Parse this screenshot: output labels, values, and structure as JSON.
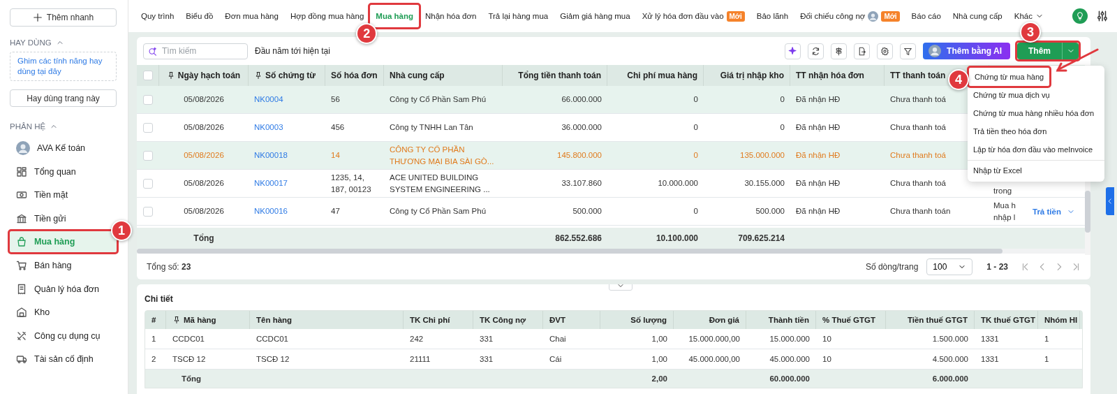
{
  "sidebar": {
    "quick_add": "Thêm nhanh",
    "favorites": {
      "title": "HAY DÙNG",
      "expanded": true,
      "hint": "Ghim các tính năng hay dùng tại đây",
      "button": "Hay dùng trang này"
    },
    "modules": {
      "title": "PHÂN HỆ",
      "expanded": true,
      "items": [
        {
          "label": "AVA Kế toán",
          "selected": false
        },
        {
          "label": "Tổng quan",
          "selected": false
        },
        {
          "label": "Tiền mặt",
          "selected": false
        },
        {
          "label": "Tiền gửi",
          "selected": false
        },
        {
          "label": "Mua hàng",
          "selected": true,
          "callout": "1"
        },
        {
          "label": "Bán hàng",
          "selected": false
        },
        {
          "label": "Quản lý hóa đơn",
          "selected": false
        },
        {
          "label": "Kho",
          "selected": false
        },
        {
          "label": "Công cụ dụng cụ",
          "selected": false
        },
        {
          "label": "Tài sản cố định",
          "selected": false
        }
      ]
    }
  },
  "tabs": [
    {
      "label": "Quy trình",
      "selected": false
    },
    {
      "label": "Biểu đồ",
      "selected": false
    },
    {
      "label": "Đơn mua hàng",
      "selected": false
    },
    {
      "label": "Hợp đồng mua hàng",
      "selected": false
    },
    {
      "label": "Mua hàng",
      "selected": true,
      "callout": "2"
    },
    {
      "label": "Nhận hóa đơn",
      "selected": false
    },
    {
      "label": "Trả lại hàng mua",
      "selected": false
    },
    {
      "label": "Giảm giá hàng mua",
      "selected": false
    },
    {
      "label": "Xử lý hóa đơn đầu vào",
      "selected": false,
      "badge": "Mới"
    },
    {
      "label": "Bảo lãnh",
      "selected": false
    },
    {
      "label": "Đối chiếu công nợ",
      "selected": false,
      "badge": "Mới",
      "avatar": true
    },
    {
      "label": "Báo cáo",
      "selected": false
    },
    {
      "label": "Nhà cung cấp",
      "selected": false
    },
    {
      "label": "Khác",
      "selected": false,
      "dropdown": true
    }
  ],
  "toolbar": {
    "search": {
      "placeholder": "Tìm kiếm"
    },
    "period": "Đầu năm tới hiện tại",
    "ai_button": "Thêm bằng AI",
    "add_button": {
      "label": "Thêm",
      "callout": "3"
    }
  },
  "add_menu": {
    "items": [
      {
        "label": "Chứng từ mua hàng",
        "callout": "4",
        "separated": false
      },
      {
        "label": "Chứng từ mua dịch vụ",
        "separated": false
      },
      {
        "label": "Chứng từ mua hàng nhiều hóa đơn",
        "separated": false
      },
      {
        "label": "Trả tiền theo hóa đơn",
        "separated": false
      },
      {
        "label": "Lập từ hóa đơn đầu vào meInvoice",
        "separated": false
      },
      {
        "label": "Nhập từ Excel",
        "separated": true
      }
    ]
  },
  "table": {
    "select_all_checked": false,
    "columns": [
      {
        "label": "Ngày hạch toán",
        "pinned": true
      },
      {
        "label": "Số chứng từ",
        "pinned": true
      },
      {
        "label": "Số hóa đơn",
        "pinned": false
      },
      {
        "label": "Nhà cung cấp",
        "pinned": false
      },
      {
        "label": "Tổng tiền thanh toán",
        "pinned": false
      },
      {
        "label": "Chi phí mua hàng",
        "pinned": false
      },
      {
        "label": "Giá trị nhập kho",
        "pinned": false
      },
      {
        "label": "TT nhận hóa đơn",
        "pinned": false
      },
      {
        "label": "TT thanh toán",
        "pinned": false
      }
    ],
    "rows": [
      {
        "selected": true,
        "checked": false,
        "color": "#333333",
        "cells": [
          "05/08/2026",
          "NK0004",
          "56",
          "Công ty Cổ Phần Sam Phú",
          "66.000.000",
          "0",
          "0",
          "Đã nhận HĐ",
          "Chưa thanh toá"
        ]
      },
      {
        "selected": false,
        "checked": false,
        "color": "#333333",
        "cells": [
          "05/08/2026",
          "NK0003",
          "456",
          "Công ty TNHH Lan Tân",
          "36.000.000",
          "0",
          "0",
          "Đã nhận HĐ",
          "Chưa thanh toá"
        ]
      },
      {
        "selected": true,
        "checked": false,
        "color": "#e07b1e",
        "cells": [
          "05/08/2026",
          "NK00018",
          "14",
          "CÔNG TY CỔ PHẦN THƯƠNG MẠI BIA SÀI GÒ...",
          "145.800.000",
          "0",
          "135.000.000",
          "Đã nhận HĐ",
          "Chưa thanh toá"
        ]
      },
      {
        "selected": false,
        "checked": false,
        "color": "#333333",
        "cells": [
          "05/08/2026",
          "NK00017",
          "1235, 14, 187, 00123",
          "ACE UNITED BUILDING SYSTEM ENGINEERING ...",
          "33.107.860",
          "10.000.000",
          "30.155.000",
          "Đã nhận HĐ",
          "Chưa thanh toá"
        ],
        "column_10": "trong"
      },
      {
        "selected": false,
        "checked": false,
        "color": "#333333",
        "cells": [
          "05/08/2026",
          "NK00016",
          "47",
          "Công ty Cổ Phần Sam Phú",
          "500.000",
          "0",
          "500.000",
          "Đã nhận HĐ",
          "Chưa thanh toán"
        ],
        "column_10": "Mua h nhập l",
        "action": "Trả tiền"
      }
    ],
    "totals": {
      "label": "Tổng",
      "total_payment": "862.552.686",
      "purchase_cost": "10.100.000",
      "stock_value": "709.625.214"
    },
    "total_count": "Tổng số: **23**",
    "pagination": {
      "page_size_label": "Số dòng/trang",
      "page_size": "100",
      "range": "1 - 23"
    }
  },
  "detail": {
    "title": "Chi tiết",
    "collapsed": false,
    "columns": [
      "#",
      "Mã hàng",
      "Tên hàng",
      "TK Chi phí",
      "TK Công nợ",
      "ĐVT",
      "Số lượng",
      "Đơn giá",
      "Thành tiền",
      "% Thuế GTGT",
      "Tiền thuế GTGT",
      "TK thuế GTGT",
      "Nhóm HI"
    ],
    "rows": [
      [
        "1",
        "CCDC01",
        "CCDC01",
        "242",
        "331",
        "Chai",
        "1,00",
        "15.000.000,00",
        "15.000.000",
        "10",
        "1.500.000",
        "1331",
        "1"
      ],
      [
        "2",
        "TSCĐ 12",
        "TSCĐ 12",
        "21111",
        "331",
        "Cái",
        "1,00",
        "45.000.000,00",
        "45.000.000",
        "10",
        "4.500.000",
        "1331",
        "1"
      ]
    ],
    "totals": {
      "label": "Tổng",
      "quantity": "2,00",
      "amount": "60.000.000",
      "tax_amount": "6.000.000"
    }
  }
}
